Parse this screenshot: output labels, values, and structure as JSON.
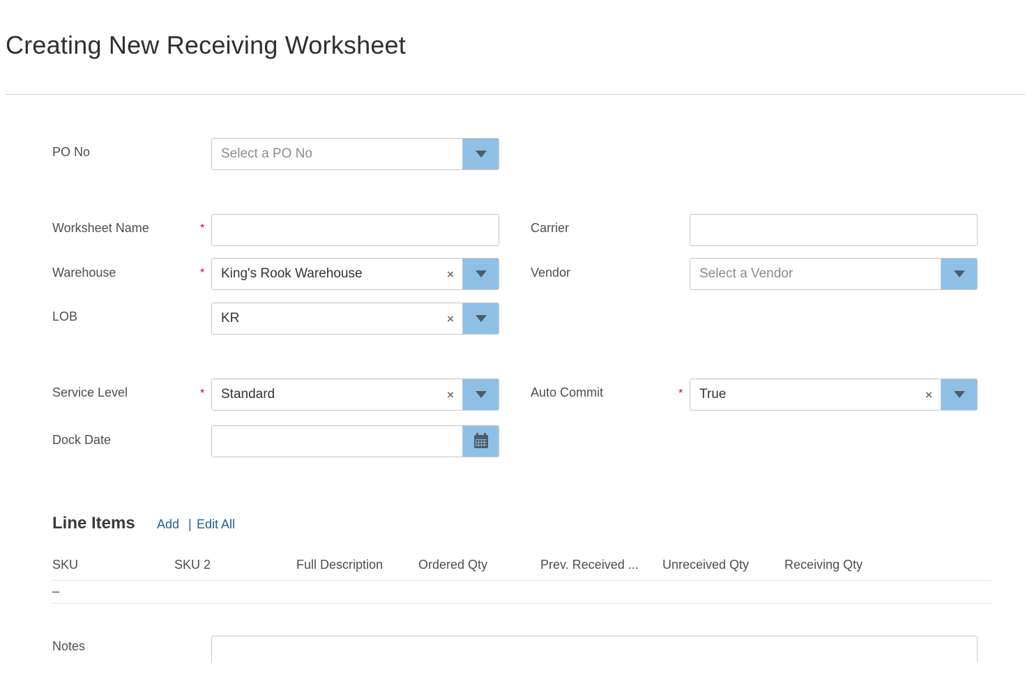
{
  "page": {
    "title": "Creating New Receiving Worksheet"
  },
  "form": {
    "po_no": {
      "label": "PO No",
      "placeholder": "Select a PO No",
      "required": false
    },
    "worksheet_name": {
      "label": "Worksheet Name",
      "value": "",
      "required": true
    },
    "carrier": {
      "label": "Carrier",
      "value": "",
      "required": false
    },
    "warehouse": {
      "label": "Warehouse",
      "value": "King's Rook Warehouse",
      "required": true,
      "clear_icon": "×"
    },
    "vendor": {
      "label": "Vendor",
      "placeholder": "Select a Vendor",
      "required": false
    },
    "lob": {
      "label": "LOB",
      "value": "KR",
      "required": false,
      "clear_icon": "×"
    },
    "service_level": {
      "label": "Service Level",
      "value": "Standard",
      "required": true,
      "clear_icon": "×"
    },
    "auto_commit": {
      "label": "Auto Commit",
      "value": "True",
      "required": true,
      "clear_icon": "×"
    },
    "dock_date": {
      "label": "Dock Date",
      "value": "",
      "required": false
    },
    "required_marker": "*"
  },
  "line_items": {
    "title": "Line Items",
    "add_label": "Add",
    "separator": "|",
    "edit_all_label": "Edit All",
    "columns": [
      "SKU",
      "SKU 2",
      "Full Description",
      "Ordered Qty",
      "Prev. Received ...",
      "Unreceived Qty",
      "Receiving Qty"
    ],
    "empty_row": "–"
  },
  "notes": {
    "label": "Notes",
    "value": ""
  },
  "colors": {
    "dropdown_button": "#8ec0e6",
    "dropdown_arrow": "#4f5b66",
    "required": "#d0021b",
    "link": "#1f5fa3"
  },
  "icons": {
    "dropdown": "chevron-down-icon",
    "clear": "clear-icon",
    "calendar": "calendar-icon"
  }
}
